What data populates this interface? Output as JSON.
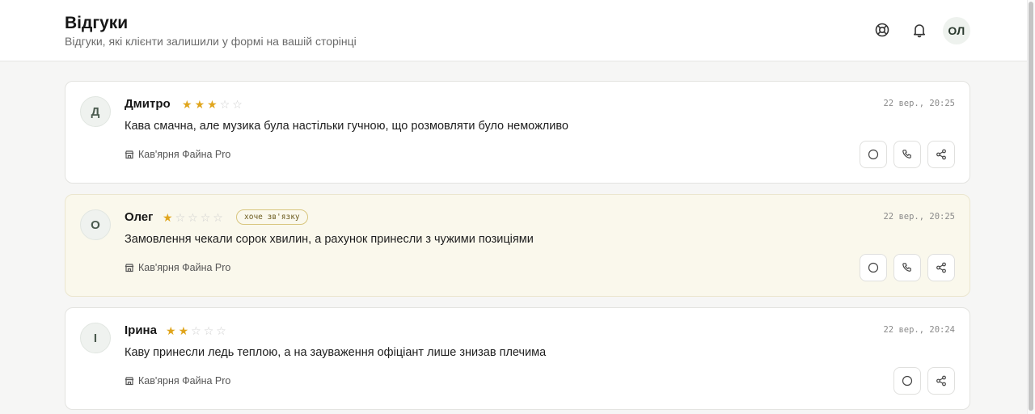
{
  "header": {
    "title": "Відгуки",
    "subtitle": "Відгуки, які клієнти залишили у формі на вашій сторінці",
    "avatar_initials": "ОЛ",
    "icons": [
      "help-icon",
      "bell-icon"
    ]
  },
  "colors": {
    "star_filled": "#e0a51c",
    "star_empty": "#cfcfcf",
    "highlight_bg": "#faf8ec"
  },
  "reviews": [
    {
      "initial": "Д",
      "name": "Дмитро",
      "rating": 3,
      "max_rating": 5,
      "time": "22 вер., 20:25",
      "text": "Кава смачна, але музика була настільки гучною, що розмовляти було неможливо",
      "place": "Кав'ярня Файна Pro",
      "actions": [
        "mark-icon",
        "phone-icon",
        "share-icon"
      ]
    },
    {
      "initial": "О",
      "name": "Олег",
      "rating": 1,
      "max_rating": 5,
      "badge": "хоче зв'язку",
      "time": "22 вер., 20:25",
      "text": "Замовлення чекали сорок хвилин, а рахунок принесли з чужими позиціями",
      "place": "Кав'ярня Файна Pro",
      "actions": [
        "mark-icon",
        "phone-icon",
        "share-icon"
      ]
    },
    {
      "initial": "І",
      "name": "Ірина",
      "rating": 2,
      "max_rating": 5,
      "time": "22 вер., 20:24",
      "text": "Каву принесли ледь теплою, а на зауваження офіціант лише знизав плечима",
      "place": "Кав'ярня Файна Pro",
      "actions": [
        "mark-icon",
        "share-icon"
      ]
    }
  ]
}
